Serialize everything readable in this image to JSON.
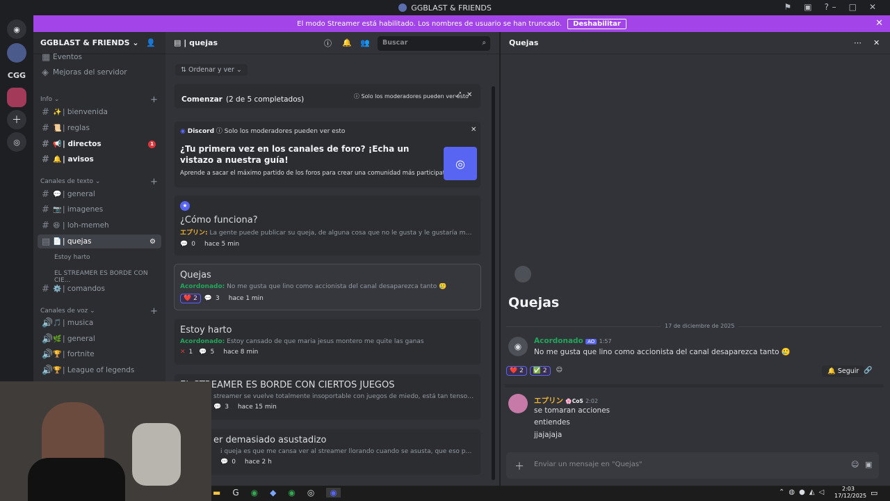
{
  "window": {
    "title": "GGBLAST & FRIENDS"
  },
  "banner": {
    "text": "El modo Streamer está habilitado. Los nombres de usuario se han truncado.",
    "button": "Deshabilitar"
  },
  "servers": [
    {
      "label": "CGG"
    }
  ],
  "sidebar": {
    "server_name": "GGBLAST & FRIENDS",
    "top_items": [
      "Eventos",
      "Mejoras del servidor"
    ],
    "categories": {
      "info": "Info",
      "text": "Canales de texto",
      "voice": "Canales de voz"
    },
    "info_channels": [
      {
        "emoji": "✨",
        "label": "| bienvenida"
      },
      {
        "emoji": "📜",
        "label": "| reglas"
      },
      {
        "emoji": "📢",
        "label": "| directos",
        "badge": "1"
      },
      {
        "emoji": "🔔",
        "label": "| avisos"
      }
    ],
    "text_channels": [
      {
        "emoji": "💬",
        "label": "| general"
      },
      {
        "emoji": "📷",
        "label": "| imagenes"
      },
      {
        "emoji": "😆",
        "label": "| loh-memeh"
      },
      {
        "emoji": "📄",
        "label": "| quejas"
      }
    ],
    "threads": [
      "Estoy harto",
      "EL STREAMER ES BORDE CON CIE..."
    ],
    "comandos": {
      "emoji": "⚙️",
      "label": "| comandos"
    },
    "voice_channels": [
      {
        "emoji": "🎵",
        "label": "| musica"
      },
      {
        "emoji": "🌿",
        "label": "| general"
      },
      {
        "emoji": "🏆",
        "label": "| fortnite"
      },
      {
        "emoji": "🏆",
        "label": "| League of legends"
      }
    ]
  },
  "center": {
    "channel": "| quejas",
    "search_placeholder": "Buscar",
    "sort": "Ordenar y ver",
    "start": {
      "title": "Comenzar",
      "progress": "(2 de 5 completados)",
      "mods": "Solo los moderadores pueden ver esto"
    },
    "guide": {
      "brand": "Discord",
      "mods": "Solo los moderadores pueden ver esto",
      "title": "¿Tu primera vez en los canales de foro? ¡Echa un vistazo a nuestra guía!",
      "sub": "Aprende a sacar el máximo partido de los foros para crear una comunidad más participativa."
    },
    "posts": [
      {
        "title": "¿Cómo funciona?",
        "author": "エプリン:",
        "preview": "La gente puede publicar su queja, de alguna cosa que no le gusta y le gustaría mejorar del serv...",
        "comments": "0",
        "time": "hace 5 min"
      },
      {
        "title": "Quejas",
        "author": "Acordonado:",
        "preview": "No me gusta que lino como accionista del canal desaparezca tanto",
        "reaction": "2",
        "comments": "3",
        "time": "hace 1 min"
      },
      {
        "title": "Estoy harto",
        "author": "Acordonado:",
        "preview": "Estoy cansado de que maria jesus montero me quite las ganas",
        "reaction": "1",
        "comments": "5",
        "time": "hace 8 min"
      },
      {
        "title": "EL STREAMER ES BORDE CON CIERTOS JUEGOS",
        "preview": "streamer se vuelve totalmente insoportable con juegos de miedo, está tan tenso que mejor ni...",
        "comments": "3",
        "time": "hace 15 min"
      },
      {
        "title": "er demasiado asustadizo",
        "preview": "i queja es que me cansa ver al streamer llorando cuando se asusta, que eso pasa constantem...",
        "comments": "0",
        "time": "hace 2 h"
      }
    ]
  },
  "right": {
    "header": "Quejas",
    "title": "Quejas",
    "date": "17 de diciembre de 2025",
    "msg1": {
      "author": "Acordonado",
      "tag": "AO",
      "time": "1:57",
      "text": "No me gusta que lino como accionista del canal desaparezca tanto",
      "r1": "2",
      "r2": "2",
      "follow": "Seguir"
    },
    "msg2": {
      "author": "エプリン",
      "tag": "CoS",
      "time": "2:02",
      "lines": [
        "se tomaran acciones",
        "entiendes",
        "jjajajaja"
      ]
    },
    "input_placeholder": "Enviar un mensaje en \"Quejas\""
  },
  "taskbar": {
    "time": "2:03",
    "date": "17/12/2025"
  }
}
